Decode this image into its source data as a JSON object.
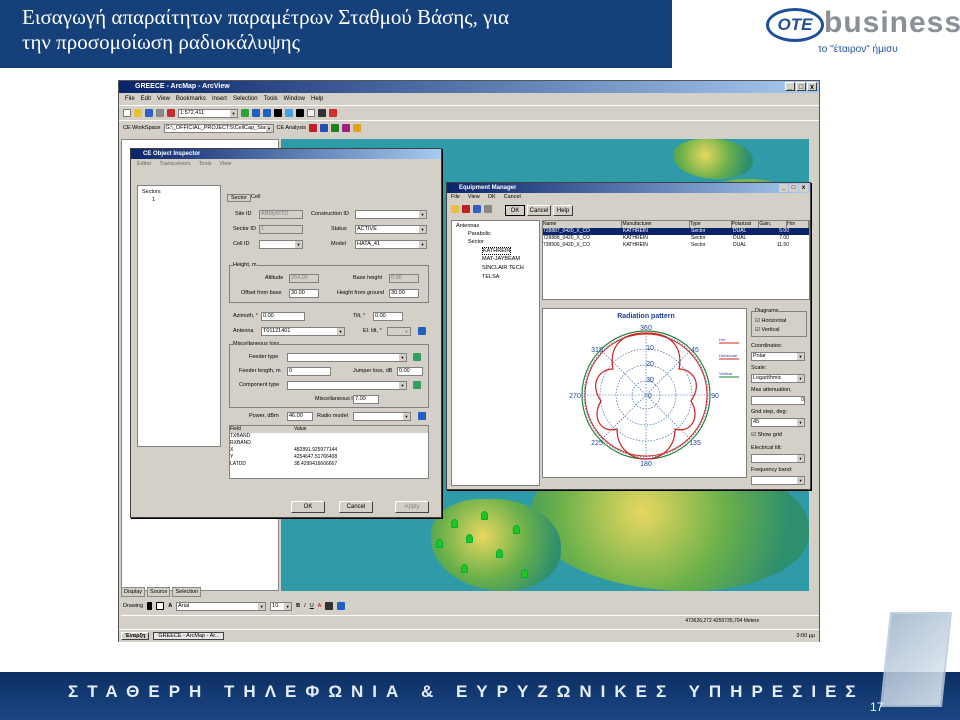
{
  "slide": {
    "title_line1": "Εισαγωγή απαραίτητων παραμέτρων Σταθμού Βάσης, για",
    "title_line2": "την προσομοίωση ραδιοκάλυψης",
    "footer_text": "ΣΤΑΘΕΡΗ ΤΗΛΕΦΩΝΙΑ & ΕΥΡΥΖΩΝΙΚΕΣ ΥΠΗΡΕΣΙΕΣ",
    "page_number": "17",
    "brand_color": "#16407a"
  },
  "logo": {
    "ote": "OTE",
    "business": "business",
    "tagline": "το \"έταιρον\" ήμισυ"
  },
  "arcmap": {
    "title": "GREECE - ArcMap - ArcView",
    "menu": [
      "File",
      "Edit",
      "View",
      "Bookmarks",
      "Insert",
      "Selection",
      "Tools",
      "Window",
      "Help"
    ],
    "scale": "1:572,411",
    "workspace_label": "CE WorkSpace",
    "workspace_path": "G:\\_OFFICIAL_PROJECTS\\CellCap_States",
    "analysis_label": "CE Analysis",
    "tabs": [
      "Display",
      "Source",
      "Selection"
    ],
    "drawing_label": "Drawing",
    "font_name": "Arial",
    "font_size": "10",
    "coords": "473626,272  4250735,704 Meters",
    "start": "Έναρξη",
    "task": "GREECE - ArcMap - Ar...",
    "clock": "3:00 μμ"
  },
  "inspector": {
    "title": "CE Object Inspector",
    "menu": [
      "Editor",
      "Transceivers",
      "Tools",
      "View"
    ],
    "tree_root": "Sectors",
    "tree_child": "1",
    "tabs": [
      "Sector",
      "Cell"
    ],
    "site_id_label": "Site ID",
    "site_id": "ABMytSTO",
    "construction_id_label": "Construction ID",
    "sector_id_label": "Sector ID",
    "sector_id": "1",
    "status_label": "Status",
    "status": "ACTIVE",
    "cell_id_label": "Cell ID",
    "model_label": "Model",
    "model": "HATA_41",
    "height_group": "Height, m",
    "altitude_label": "Altitude",
    "altitude": "254.00",
    "base_height_label": "Base height",
    "base_height": "0.00",
    "offset_label": "Offset from base",
    "offset": "30.00",
    "height_ground_label": "Height from ground",
    "height_ground": "30.00",
    "azimuth_label": "Azimuth, °",
    "azimuth": "0.00",
    "tilt_label": "Tilt, °",
    "tilt": "0.00",
    "antenna_label": "Antenna",
    "antenna": "T01121401",
    "el_tilt_label": "El. tilt, °",
    "misc_group": "Miscellaneous loss",
    "feeder_type_label": "Feeder type",
    "feeder_length_label": "Feeder length, m",
    "feeder_length": "0",
    "jumper_loss_label": "Jumper loss, dB",
    "jumper_loss": "0.00",
    "component_type_label": "Component type",
    "misc_loss_label": "Miscellaneous loss, dB",
    "misc_loss": "7.00",
    "power_label": "Power, dBm",
    "power": "46.00",
    "radio_model_label": "Radio model",
    "grid_headers": [
      "Field",
      "Value"
    ],
    "grid_rows": [
      [
        "TXBAND",
        ""
      ],
      [
        "RXBAND",
        ""
      ],
      [
        "X",
        "482891.925977144"
      ],
      [
        "Y",
        "4254647.51766408"
      ],
      [
        "LATDD",
        "38.4299416666667"
      ]
    ],
    "ok": "OK",
    "cancel": "Cancel",
    "apply": "Apply"
  },
  "equipment": {
    "title": "Equipment Manager",
    "menu": [
      "File",
      "View",
      "OK",
      "Cancel"
    ],
    "ok": "OK",
    "cancel": "Cancel",
    "help": "Help",
    "tree": [
      "Antennas",
      "Parabolic",
      "Sector",
      "KATHREIN",
      "MAT-JAYBEAM",
      "SINCLAIR TECH",
      "TELSA"
    ],
    "headers": [
      "Name",
      "Manufacturer",
      "Type",
      "Polarizat",
      "Gain,",
      "Hor"
    ],
    "rows": [
      [
        "728887_0420_X_CO",
        "KATHREIN",
        "Sector",
        "DUAL",
        "5.00"
      ],
      [
        "728888_0420_X_CO",
        "KATHREIN",
        "Sector",
        "DUAL",
        "7.00"
      ],
      [
        "739506_0420_X_CO",
        "KATHREIN",
        "Sector",
        "DUAL",
        "11.50"
      ]
    ],
    "pattern_title": "Radiation pattern",
    "pattern_labels": [
      "360",
      "315",
      "45",
      "270",
      "90",
      "225",
      "135",
      "180",
      "10",
      "20",
      "30",
      "0"
    ],
    "legend": [
      "Hor",
      "Horizontal",
      "Vertical"
    ],
    "diagrams_label": "Diagrams",
    "horizontal": "Horizontal",
    "vertical": "Vertical",
    "coordinates_label": "Coordinates:",
    "coordinates": "Polar",
    "scale_label": "Scale:",
    "scale": "Logarithmic",
    "max_att_label": "Max attenuation,",
    "max_att": "0",
    "grid_step_label": "Grid step, deg:",
    "grid_step": "45",
    "show_grid": "Show grid",
    "elec_tilt_label": "Electrical tilt:",
    "freq_band_label": "Frequency band:"
  }
}
